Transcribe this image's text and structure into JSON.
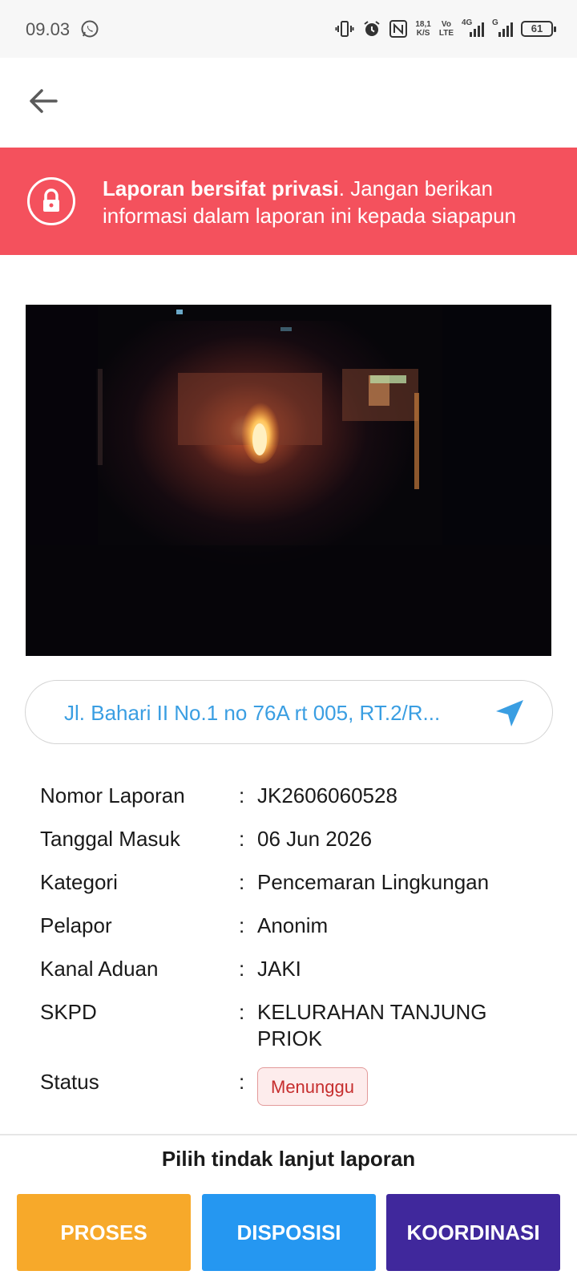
{
  "status_bar": {
    "time": "09.03",
    "speed_top": "18,1",
    "speed_bottom": "K/S",
    "volte_top": "Vo",
    "volte_bottom": "LTE",
    "network_4g": "4G",
    "network_g": "G",
    "battery": "61",
    "icons": [
      "whatsapp-icon",
      "vibrate-icon",
      "alarm-icon",
      "nfc-icon",
      "signal-icon"
    ]
  },
  "header": {
    "back_icon": "arrow-left-icon"
  },
  "banner": {
    "bold_text": "Laporan bersifat privasi",
    "text": ". Jangan berikan informasi dalam laporan ini kepada siapapun",
    "icon": "lock-icon",
    "color": "#f4515d"
  },
  "address": {
    "text": "Jl. Bahari II No.1 no 76A rt 005, RT.2/R...",
    "icon": "navigation-arrow-icon",
    "color": "#3a9ee2"
  },
  "details": [
    {
      "label": "Nomor Laporan",
      "value": "JK2606060528"
    },
    {
      "label": "Tanggal Masuk",
      "value": "06 Jun 2026"
    },
    {
      "label": "Kategori",
      "value": "Pencemaran Lingkungan"
    },
    {
      "label": "Pelapor",
      "value": "Anonim"
    },
    {
      "label": "Kanal Aduan",
      "value": "JAKI"
    },
    {
      "label": "SKPD",
      "value": "KELURAHAN TANJUNG PRIOK"
    }
  ],
  "status": {
    "label": "Status",
    "value": "Menunggu",
    "colon": ":"
  },
  "colon": ":",
  "actions": {
    "title": "Pilih tindak lanjut laporan",
    "proses": "PROSES",
    "disposisi": "DISPOSISI",
    "koordinasi": "KOORDINASI",
    "colors": {
      "proses": "#f7a92a",
      "disposisi": "#2597f1",
      "koordinasi": "#40289c"
    }
  }
}
